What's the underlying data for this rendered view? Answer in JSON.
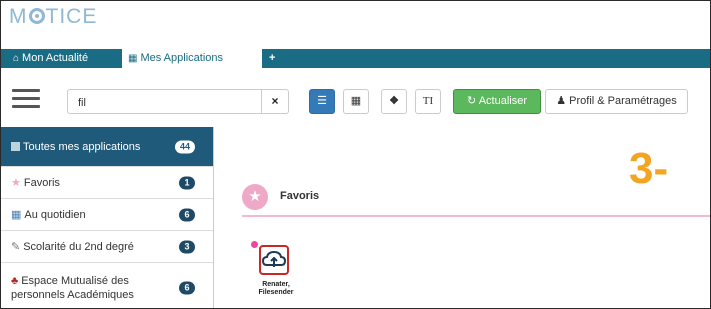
{
  "header": {
    "logo_text_a": "M",
    "logo_text_b": "TICE"
  },
  "tabs": {
    "news": {
      "label": "Mon Actualité",
      "icon": "home-icon"
    },
    "apps": {
      "label": "Mes Applications",
      "icon": "grid-icon"
    },
    "add": {
      "label": "+"
    }
  },
  "toolbar": {
    "search_value": "fil",
    "clear_label": "×",
    "info_label": "❶",
    "text_label": "TI",
    "refresh_label": "Actualiser",
    "profile_label": "Profil & Paramétrages",
    "accent": "#5cb85c",
    "primary": "#337ab7"
  },
  "sidebar": {
    "items": [
      {
        "label": "Toutes mes applications",
        "count": "44"
      },
      {
        "label": "Favoris",
        "count": "1"
      },
      {
        "label": "Au quotidien",
        "count": "6"
      },
      {
        "label": "Scolarité du 2nd degré",
        "count": "3"
      },
      {
        "label": "Espace Mutualisé des personnels Académiques",
        "count": "6"
      }
    ]
  },
  "main": {
    "step_label": "3-",
    "section_title": "Favoris",
    "app": {
      "label_line1": "Renater,",
      "label_line2": "Filesender"
    }
  }
}
